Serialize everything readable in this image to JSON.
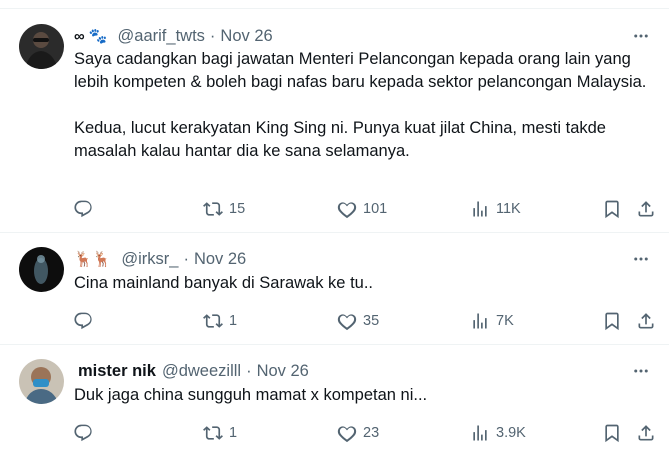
{
  "tweets": [
    {
      "avatar": "avatar-dark-portrait",
      "display_name_emoji": "∞ 🐾",
      "display_name": "",
      "handle": "@aarif_twts",
      "time": "Nov 26",
      "paragraphs": [
        "Saya cadangkan bagi jawatan Menteri Pelancongan kepada orang lain yang lebih kompeten & boleh bagi nafas baru kepada sektor pelancongan Malaysia.",
        "Kedua, lucut kerakyatan King Sing ni. Punya kuat jilat China, mesti takde masalah kalau hantar dia ke sana selamanya."
      ],
      "replies": "",
      "retweets": "15",
      "likes": "101",
      "views": "11K"
    },
    {
      "avatar": "avatar-ghost-figure",
      "display_name_emoji": "🦌🦌",
      "display_name": "",
      "handle": "@irksr_",
      "time": "Nov 26",
      "paragraphs": [
        "Cina mainland banyak di Sarawak ke tu.."
      ],
      "replies": "",
      "retweets": "1",
      "likes": "35",
      "views": "7K"
    },
    {
      "avatar": "avatar-masked-man",
      "display_name_emoji": "",
      "display_name": "mister nik",
      "handle": "@dweezilll",
      "time": "Nov 26",
      "paragraphs": [
        "Duk jaga china sungguh mamat x kompetan ni..."
      ],
      "replies": "",
      "retweets": "1",
      "likes": "23",
      "views": "3.9K"
    }
  ],
  "separator": "·",
  "colors": {
    "text": "#0f1419",
    "secondary": "#536471",
    "border": "#eff3f4"
  }
}
